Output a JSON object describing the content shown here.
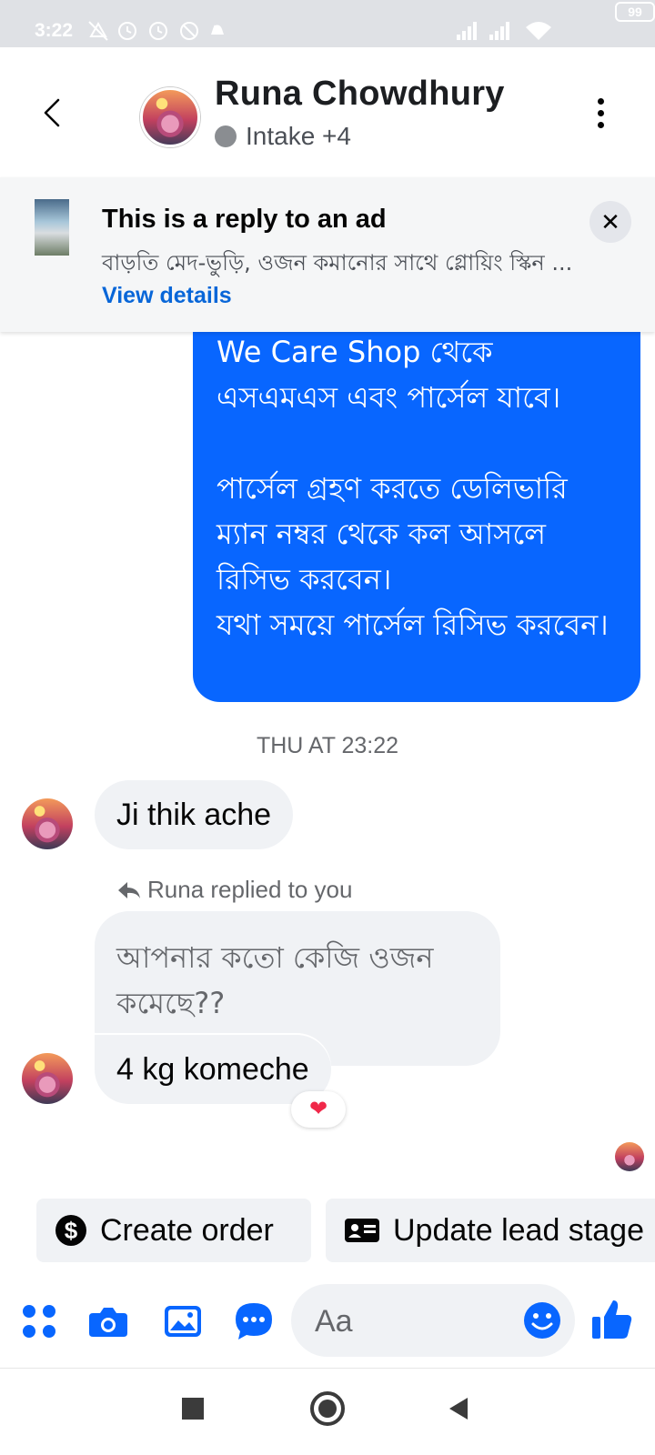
{
  "status_bar": {
    "time": "3:22",
    "battery": "99",
    "icons": [
      "mute-icon",
      "alarm-icon",
      "alarm-icon",
      "no-disturb-icon",
      "notification-icon",
      "signal-icon",
      "signal-icon",
      "wifi-icon",
      "battery-icon"
    ]
  },
  "header": {
    "contact_name": "Runa Chowdhury",
    "status_text": "Intake +4",
    "back_icon": "chevron-left-icon",
    "more_icon": "more-vertical-icon"
  },
  "ad_banner": {
    "title": "This is a reply to an ad",
    "text": "বাড়তি মেদ-ভুড়ি, ওজন কমানোর সাথে গ্লোয়িং স্কিন ... ",
    "link": "View details",
    "close_icon": "close-icon"
  },
  "messages": {
    "outgoing_text": "We Care Shop থেকে এসএমএস এবং পার্সেল যাবে।\n\nপার্সেল গ্রহণ করতে ডেলিভারি ম্যান নম্বর থেকে কল আসলে রিসিভ করবেন।\nযথা সময়ে পার্সেল রিসিভ করবেন।",
    "timestamp": "THU AT 23:22",
    "incoming_1": "Ji thik ache",
    "reply_label": "Runa replied to you",
    "quoted_text": "আপনার কতো কেজি ওজন কমেছে??",
    "incoming_2": "4 kg komeche",
    "reaction": "❤"
  },
  "actions": {
    "create_order": "Create order",
    "update_lead_stage": "Update lead stage"
  },
  "composer": {
    "placeholder": "Aa",
    "icons": [
      "menu-icon",
      "camera-icon",
      "image-icon",
      "chat-icon",
      "emoji-icon",
      "like-icon"
    ]
  },
  "nav": {
    "icons": [
      "recent-apps-icon",
      "home-icon",
      "back-icon"
    ]
  },
  "colors": {
    "accent": "#0866ff",
    "bubble_incoming": "#f0f2f5",
    "link": "#0866d8"
  }
}
